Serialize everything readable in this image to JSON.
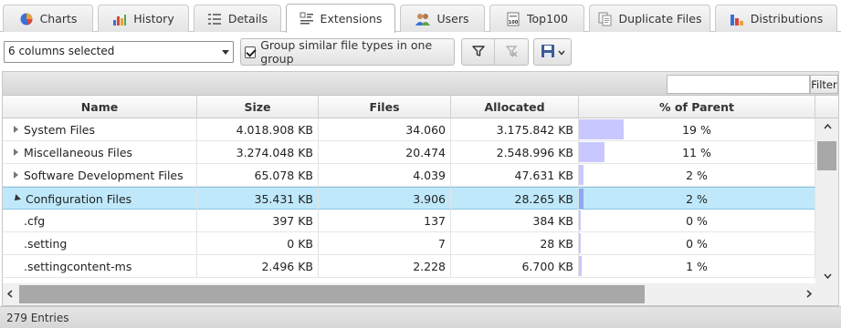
{
  "tabs": [
    {
      "label": "Charts",
      "icon": "pie-chart-icon"
    },
    {
      "label": "History",
      "icon": "history-chart-icon"
    },
    {
      "label": "Details",
      "icon": "details-list-icon"
    },
    {
      "label": "Extensions",
      "icon": "extensions-list-icon",
      "active": true
    },
    {
      "label": "Users",
      "icon": "users-icon"
    },
    {
      "label": "Top100",
      "icon": "top100-icon"
    },
    {
      "label": "Duplicate Files",
      "icon": "duplicate-files-icon"
    },
    {
      "label": "Distributions",
      "icon": "distributions-chart-icon"
    }
  ],
  "toolbar": {
    "columns_select": "6 columns selected",
    "group_label": "Group similar file types in one group",
    "group_checked": true
  },
  "filter": {
    "button": "Filter",
    "value": ""
  },
  "columns": [
    "Name",
    "Size",
    "Files",
    "Allocated",
    "% of Parent"
  ],
  "rows": [
    {
      "name": "System Files",
      "size": "4.018.908 KB",
      "files": "34.060",
      "allocated": "3.175.842 KB",
      "pct": "19 %",
      "pct_value": 19,
      "expander": "collapsed"
    },
    {
      "name": "Miscellaneous Files",
      "size": "3.274.048 KB",
      "files": "20.474",
      "allocated": "2.548.996 KB",
      "pct": "11 %",
      "pct_value": 11,
      "expander": "collapsed"
    },
    {
      "name": "Software Development Files",
      "size": "65.078 KB",
      "files": "4.039",
      "allocated": "47.631 KB",
      "pct": "2 %",
      "pct_value": 2,
      "expander": "collapsed"
    },
    {
      "name": "Configuration Files",
      "size": "35.431 KB",
      "files": "3.906",
      "allocated": "28.265 KB",
      "pct": "2 %",
      "pct_value": 2,
      "expander": "expanded",
      "selected": true
    },
    {
      "name": ".cfg",
      "size": "397 KB",
      "files": "137",
      "allocated": "384 KB",
      "pct": "0 %",
      "pct_value": 0,
      "expander": "none"
    },
    {
      "name": ".setting",
      "size": "0 KB",
      "files": "7",
      "allocated": "28 KB",
      "pct": "0 %",
      "pct_value": 0,
      "expander": "none"
    },
    {
      "name": ".settingcontent-ms",
      "size": "2.496 KB",
      "files": "2.228",
      "allocated": "6.700 KB",
      "pct": "1 %",
      "pct_value": 1,
      "expander": "none"
    }
  ],
  "status": {
    "entries": "279 Entries"
  },
  "colors": {
    "accent": "#bfe9fb",
    "pct_bar": "#c8c8ff"
  }
}
